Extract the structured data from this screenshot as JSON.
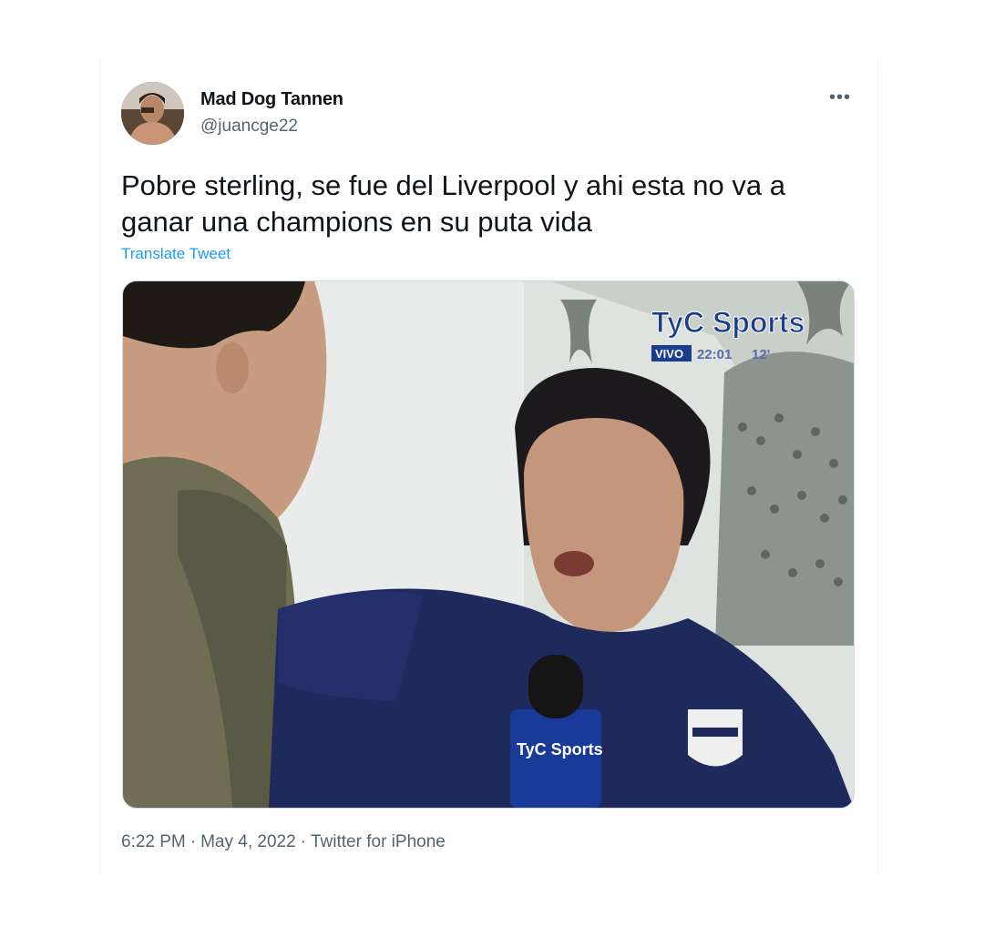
{
  "author": {
    "display_name": "Mad Dog Tannen",
    "handle": "@juancge22"
  },
  "tweet": {
    "text": "Pobre sterling, se fue del Liverpool y ahi esta no va a ganar una champions en su puta vida",
    "translate_label": "Translate Tweet",
    "time": "6:22 PM",
    "date": "May 4, 2022",
    "source": "Twitter for iPhone",
    "separator": "·"
  },
  "media": {
    "broadcaster_logo": "TyC Sports",
    "live_badge": "VIVO",
    "clock": "22:01",
    "score_fragment": "12'",
    "mic_logo": "TyC Sports"
  },
  "icons": {
    "more": "more-options-icon"
  },
  "colors": {
    "link": "#1d9bf0",
    "text_primary": "#0f1419",
    "text_secondary": "#536471"
  }
}
